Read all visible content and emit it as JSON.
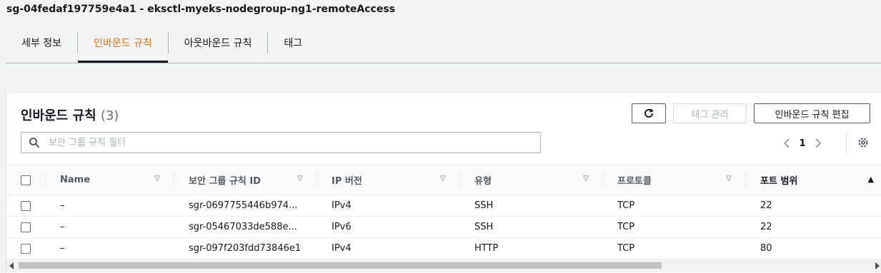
{
  "header": {
    "title": "sg-04fedaf197759e4a1 - eksctl-myeks-nodegroup-ng1-remoteAccess"
  },
  "tabs": [
    {
      "label": "세부 정보",
      "active": false
    },
    {
      "label": "인바운드 규칙",
      "active": true
    },
    {
      "label": "아웃바운드 규칙",
      "active": false
    },
    {
      "label": "태그",
      "active": false
    }
  ],
  "panel": {
    "title": "인바운드 규칙",
    "count": "(3)",
    "manage_tags_label": "태그 관리",
    "edit_rules_label": "인바운드 규칙 편집",
    "search_placeholder": "보안 그룹 규칙 필터",
    "page_number": "1"
  },
  "table": {
    "columns": [
      "Name",
      "보안 그룹 규칙 ID",
      "IP 버전",
      "유형",
      "프로토콜",
      "포트 범위"
    ],
    "rows": [
      {
        "name": "–",
        "id": "sgr-0697755446b974...",
        "ip": "IPv4",
        "type": "SSH",
        "protocol": "TCP",
        "port": "22"
      },
      {
        "name": "–",
        "id": "sgr-05467033de588e...",
        "ip": "IPv6",
        "type": "SSH",
        "protocol": "TCP",
        "port": "22"
      },
      {
        "name": "–",
        "id": "sgr-097f203fdd73846e1",
        "ip": "IPv4",
        "type": "HTTP",
        "protocol": "TCP",
        "port": "80"
      }
    ]
  },
  "colors": {
    "accent": "#ec7211",
    "text": "#16191f",
    "border": "#aab7b8"
  }
}
